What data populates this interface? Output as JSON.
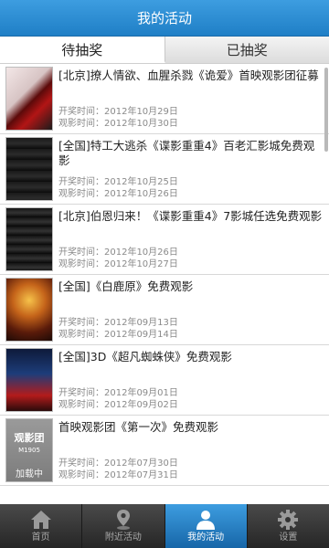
{
  "header": {
    "title": "我的活动"
  },
  "tabs": [
    {
      "label": "待抽奖",
      "active": true
    },
    {
      "label": "已抽奖",
      "active": false
    }
  ],
  "labels": {
    "draw_prefix": "开奖时间：",
    "watch_prefix": "观影时间："
  },
  "items": [
    {
      "title": "[北京]撩人情欲、血腥杀戮《诡爱》首映观影团征募",
      "draw_time": "开奖时间：2012年10月29日",
      "watch_time": "观影时间：2012年10月30日",
      "poster": "red-poster"
    },
    {
      "title": "[全国]特工大逃杀《谍影重重4》百老汇影城免费观影",
      "draw_time": "开奖时间：2012年10月25日",
      "watch_time": "观影时间：2012年10月26日",
      "poster": "dark-poster"
    },
    {
      "title": "[北京]伯恩归来！《谍影重重4》7影城任选免费观影",
      "draw_time": "开奖时间：2012年10月26日",
      "watch_time": "观影时间：2012年10月27日",
      "poster": "dark-poster"
    },
    {
      "title": "[全国]《白鹿原》免费观影",
      "draw_time": "开奖时间：2012年09月13日",
      "watch_time": "观影时间：2012年09月14日",
      "poster": "fire-poster"
    },
    {
      "title": "[全国]3D《超凡蜘蛛侠》免费观影",
      "draw_time": "开奖时间：2012年09月01日",
      "watch_time": "观影时间：2012年09月02日",
      "poster": "spider-poster"
    },
    {
      "title": "首映观影团《第一次》免费观影",
      "draw_time": "开奖时间：2012年07月30日",
      "watch_time": "观影时间：2012年07月31日",
      "poster": "logo-poster",
      "poster_logo": "观影团",
      "poster_sub": "M1905",
      "poster_loading": "加载中"
    }
  ],
  "bottom_nav": [
    {
      "label": "首页",
      "icon": "home-icon",
      "active": false
    },
    {
      "label": "附近活动",
      "icon": "location-pin-icon",
      "active": false
    },
    {
      "label": "我的活动",
      "icon": "user-icon",
      "active": true
    },
    {
      "label": "设置",
      "icon": "gear-icon",
      "active": false
    }
  ],
  "colors": {
    "accent": "#2385cf",
    "bar_dark": "#333333"
  }
}
